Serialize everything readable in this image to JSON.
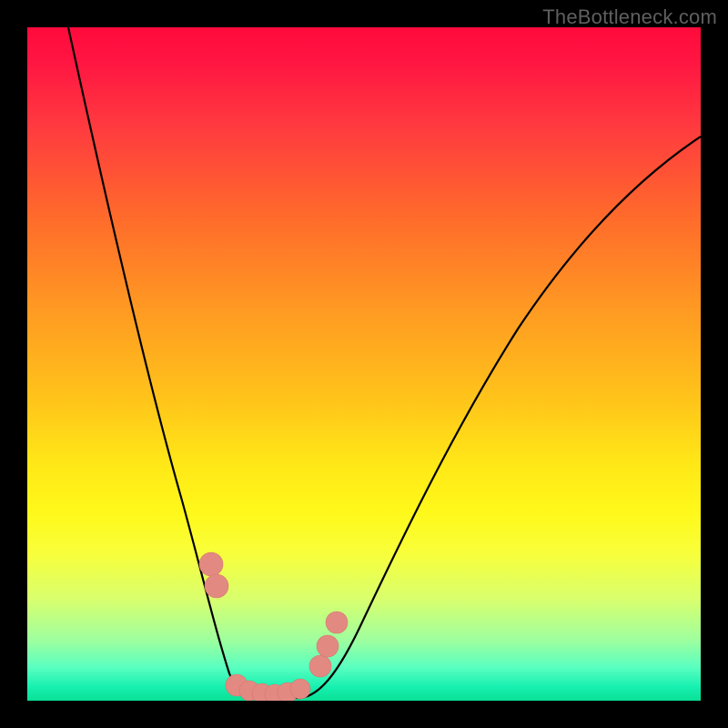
{
  "watermark": {
    "text": "TheBottleneck.com"
  },
  "chart_data": {
    "type": "line",
    "title": "",
    "xlabel": "",
    "ylabel": "",
    "xlim": [
      0,
      100
    ],
    "ylim": [
      0,
      100
    ],
    "series": [
      {
        "name": "bottleneck-curve",
        "x": [
          0,
          3,
          6,
          9,
          12,
          15,
          18,
          21,
          24,
          26,
          28,
          30,
          32,
          34,
          36,
          40,
          45,
          50,
          55,
          60,
          65,
          70,
          75,
          80,
          85,
          90,
          95,
          100
        ],
        "values": [
          100,
          92,
          84,
          76,
          68,
          60,
          52,
          44,
          36,
          28,
          20,
          12,
          6,
          2,
          0,
          0,
          4,
          12,
          22,
          32,
          42,
          50,
          58,
          64,
          70,
          74,
          78,
          80
        ]
      }
    ],
    "markers": {
      "name": "highlight-points",
      "color": "#e28a82",
      "radius_major": 13,
      "radius_minor": 11,
      "points": [
        {
          "x": 27.0,
          "y": 21.0
        },
        {
          "x": 27.8,
          "y": 17.5
        },
        {
          "x": 30.5,
          "y": 2.5
        },
        {
          "x": 32.0,
          "y": 1.7
        },
        {
          "x": 34.0,
          "y": 1.3
        },
        {
          "x": 36.0,
          "y": 1.2
        },
        {
          "x": 38.0,
          "y": 1.5
        },
        {
          "x": 40.0,
          "y": 2.0
        },
        {
          "x": 43.0,
          "y": 5.5
        },
        {
          "x": 44.0,
          "y": 8.5
        },
        {
          "x": 45.5,
          "y": 12.0
        }
      ]
    },
    "gradient_stops": [
      {
        "pct": 0,
        "color": "#ff0a3c"
      },
      {
        "pct": 15,
        "color": "#ff3b3f"
      },
      {
        "pct": 42,
        "color": "#ff9a22"
      },
      {
        "pct": 65,
        "color": "#ffe817"
      },
      {
        "pct": 85,
        "color": "#d8ff6e"
      },
      {
        "pct": 100,
        "color": "#0ae095"
      }
    ]
  }
}
